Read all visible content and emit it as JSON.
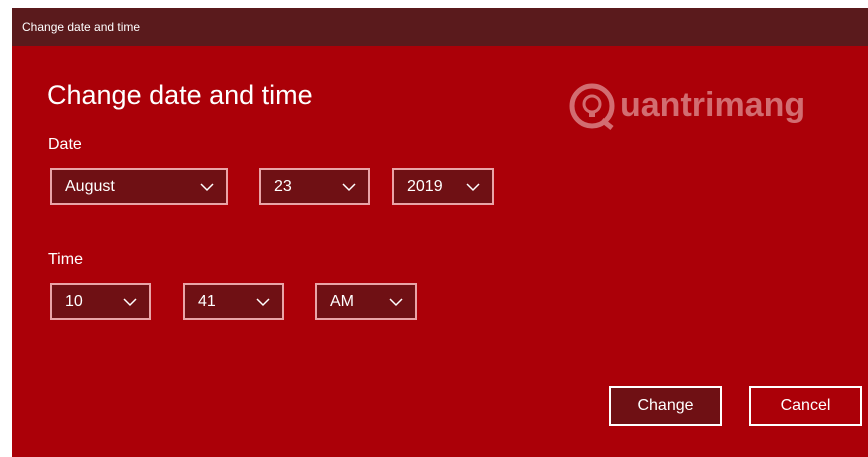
{
  "window": {
    "title": "Change date and time"
  },
  "heading": "Change date and time",
  "watermark": {
    "text": "uantrimang"
  },
  "date": {
    "label": "Date",
    "month": "August",
    "day": "23",
    "year": "2019"
  },
  "time": {
    "label": "Time",
    "hour": "10",
    "minute": "41",
    "period": "AM"
  },
  "buttons": {
    "change": "Change",
    "cancel": "Cancel"
  },
  "colors": {
    "accent": "#ab0008",
    "titlebar": "#5a1a1c",
    "control": "#6f1014"
  },
  "icons": [
    "chevron-down-icon",
    "brand-logo-icon"
  ]
}
